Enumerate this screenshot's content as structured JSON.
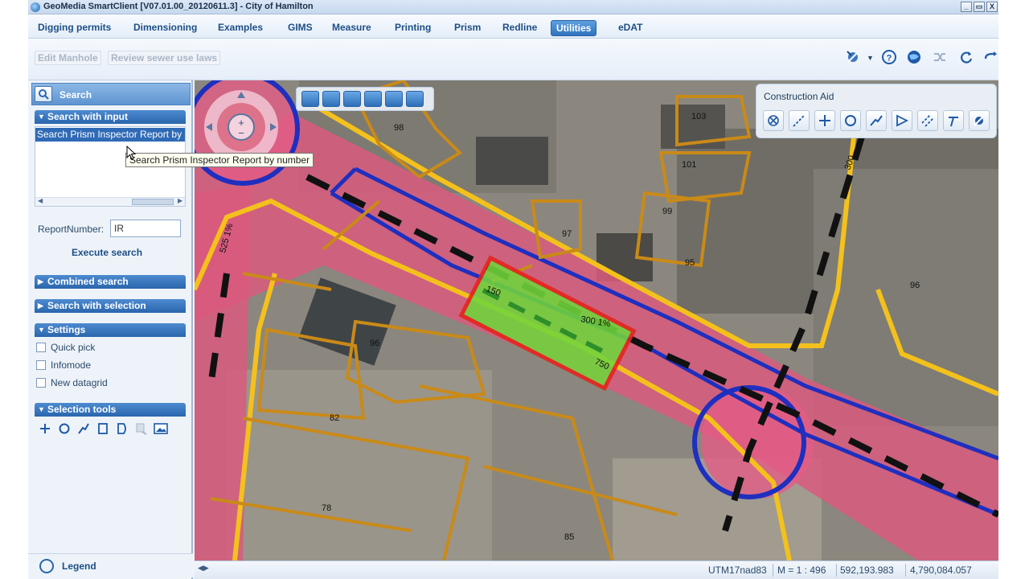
{
  "window": {
    "title": "GeoMedia SmartClient  [V07.01.00_20120611.3] - City of Hamilton",
    "controls": [
      "_",
      "▭",
      "X"
    ]
  },
  "menu_tabs": [
    {
      "label": "Digging permits",
      "active": false
    },
    {
      "label": "Dimensioning",
      "active": false
    },
    {
      "label": "Examples",
      "active": false
    },
    {
      "label": "GIMS",
      "active": false
    },
    {
      "label": "Measure",
      "active": false
    },
    {
      "label": "Printing",
      "active": false
    },
    {
      "label": "Prism",
      "active": false
    },
    {
      "label": "Redline",
      "active": false
    },
    {
      "label": "Utilities",
      "active": true
    },
    {
      "label": "eDAT",
      "active": false
    }
  ],
  "ribbon": {
    "edit_manhole": "Edit Manhole",
    "review_sewer": "Review sewer use laws",
    "icons": [
      "map-tools-icon",
      "help-icon",
      "globe-icon",
      "shuffle-icon",
      "refresh-icon",
      "redo-icon"
    ]
  },
  "search_panel": {
    "title": "Search",
    "search_with_input": "Search with input",
    "selected_item": "Search Prism Inspector Report by",
    "report_number_label": "ReportNumber:",
    "report_number_value": "IR",
    "execute_label": "Execute search",
    "combined_search": "Combined search",
    "search_with_selection": "Search with selection",
    "settings": "Settings",
    "options": [
      {
        "label": "Quick pick",
        "checked": false
      },
      {
        "label": "Infomode",
        "checked": false
      },
      {
        "label": "New datagrid",
        "checked": false
      }
    ],
    "selection_tools": "Selection tools",
    "legend": "Legend"
  },
  "tooltip": "Search Prism Inspector Report by number",
  "construction_aid": {
    "title": "Construction Aid"
  },
  "map_labels": {
    "lots": [
      "98",
      "103",
      "101",
      "99",
      "97",
      "95",
      "96",
      "96",
      "82",
      "78",
      "85"
    ],
    "pipe_labels": [
      "150",
      "300  1%",
      "750",
      "300",
      "525 1%"
    ]
  },
  "statusbar": {
    "crs": "UTM17nad83",
    "scale": "M = 1 : 496",
    "x": "592,193.983",
    "y": "4,790,084.057"
  },
  "colors": {
    "accent": "#2f6ab6",
    "road": "#e2577f",
    "parcel": "#c98a18",
    "curb": "#f4c11c",
    "highlight": "#6fd63b",
    "selection": "#e5231a"
  }
}
